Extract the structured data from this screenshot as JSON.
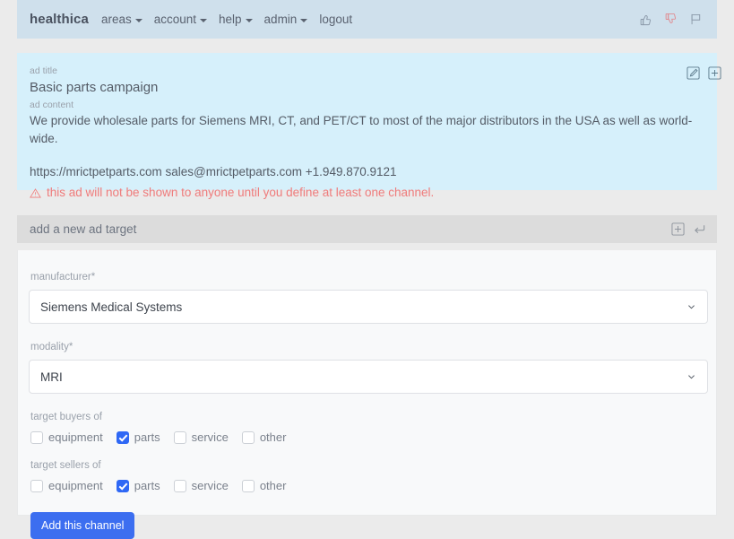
{
  "navbar": {
    "brand": "healthica",
    "items": [
      {
        "label": "areas",
        "has_caret": true,
        "icon": "chevron-down-icon"
      },
      {
        "label": "account",
        "has_caret": true,
        "icon": "chevron-down-icon"
      },
      {
        "label": "help",
        "has_caret": true,
        "icon": "chevron-down-icon"
      },
      {
        "label": "admin",
        "has_caret": true,
        "icon": "chevron-down-icon"
      },
      {
        "label": "logout",
        "has_caret": false,
        "icon": ""
      }
    ],
    "actions": [
      {
        "name": "thumbs-up-icon",
        "color": "#8a98a8"
      },
      {
        "name": "thumbs-down-icon",
        "color": "#e08a90"
      },
      {
        "name": "flag-icon",
        "color": "#8a98a8"
      }
    ],
    "background": "#cfe0ec"
  },
  "ad_card": {
    "background": "#d6f0fb",
    "title_label": "ad title",
    "title": "Basic parts campaign",
    "content_label": "ad content",
    "content": "We provide wholesale parts for Siemens MRI, CT, and PET/CT to most of the major distributors in the USA as well as world-wide.",
    "contact": "https://mrictpetparts.com sales@mrictpetparts.com +1.949.870.9121",
    "warning": "this ad will not be shown to anyone until you define at least one channel.",
    "warning_color": "#ef7b7b",
    "warning_icon": "warning-triangle-icon",
    "actions": [
      {
        "name": "edit-icon"
      },
      {
        "name": "plus-square-icon"
      }
    ]
  },
  "target_panel": {
    "header_title": "add a new ad target",
    "header_background": "#dcdcdc",
    "header_actions": [
      {
        "name": "plus-square-icon"
      },
      {
        "name": "return-arrow-icon"
      }
    ],
    "fields": [
      {
        "label": "manufacturer*",
        "value": "Siemens Medical Systems",
        "name": "manufacturer-select"
      },
      {
        "label": "modality*",
        "value": "MRI",
        "name": "modality-select"
      }
    ],
    "checkbox_groups": [
      {
        "label": "target buyers of",
        "name": "target-buyers",
        "options": [
          {
            "label": "equipment",
            "checked": false
          },
          {
            "label": "parts",
            "checked": true
          },
          {
            "label": "service",
            "checked": false
          },
          {
            "label": "other",
            "checked": false
          }
        ]
      },
      {
        "label": "target sellers of",
        "name": "target-sellers",
        "options": [
          {
            "label": "equipment",
            "checked": false
          },
          {
            "label": "parts",
            "checked": true
          },
          {
            "label": "service",
            "checked": false
          },
          {
            "label": "other",
            "checked": false
          }
        ]
      }
    ],
    "submit_label": "Add this channel",
    "submit_color": "#3c6ef0"
  }
}
